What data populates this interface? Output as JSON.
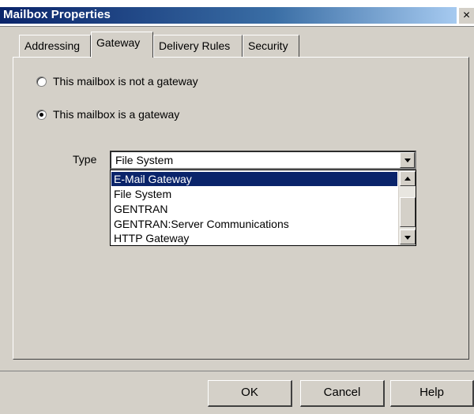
{
  "window": {
    "title": "Mailbox Properties",
    "close_glyph": "×",
    "close_icon": "close-icon"
  },
  "tabs": [
    {
      "label": "Addressing",
      "active": false
    },
    {
      "label": "Gateway",
      "active": true
    },
    {
      "label": "Delivery Rules",
      "active": false
    },
    {
      "label": "Security",
      "active": false
    }
  ],
  "gateway": {
    "option_not_gateway": {
      "label": "This mailbox is not a gateway",
      "checked": false
    },
    "option_is_gateway": {
      "label": "This mailbox is a gateway",
      "checked": true
    },
    "type_label": "Type",
    "type_value": "File System",
    "dropdown_open": true,
    "options": [
      {
        "label": "E-Mail Gateway",
        "highlighted": true
      },
      {
        "label": "File System",
        "highlighted": false
      },
      {
        "label": "GENTRAN",
        "highlighted": false
      },
      {
        "label": "GENTRAN:Server Communications",
        "highlighted": false
      },
      {
        "label": "HTTP Gateway",
        "highlighted": false
      }
    ]
  },
  "buttons": {
    "ok": "OK",
    "cancel": "Cancel",
    "help": "Help"
  },
  "colors": {
    "dialog_bg": "#d4d0c8",
    "title_bar": "#0a246a",
    "selection": "#0a246a"
  }
}
